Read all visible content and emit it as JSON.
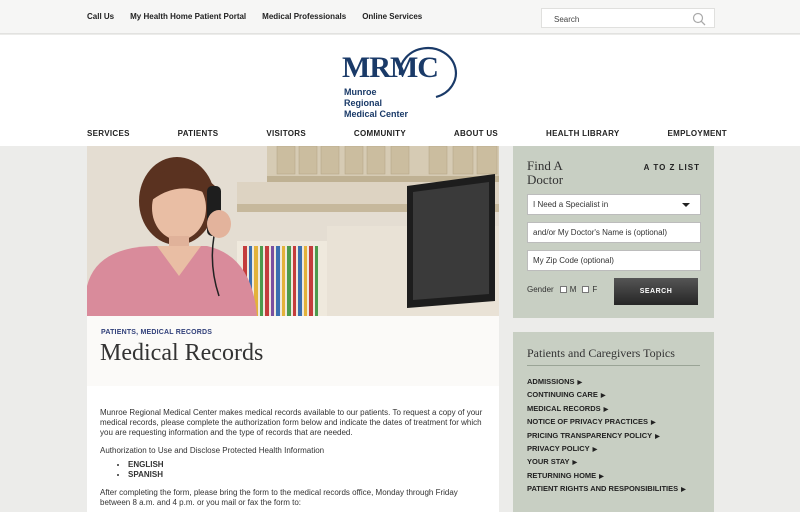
{
  "topbar": {
    "links": [
      "Call Us",
      "My Health Home Patient Portal",
      "Medical Professionals",
      "Online Services"
    ],
    "search_placeholder": "Search"
  },
  "logo": {
    "mark": "MRMC",
    "line1": "Munroe",
    "line2": "Regional",
    "line3": "Medical Center"
  },
  "nav": [
    "SERVICES",
    "PATIENTS",
    "VISITORS",
    "COMMUNITY",
    "ABOUT US",
    "HEALTH LIBRARY",
    "EMPLOYMENT"
  ],
  "hero": {
    "kicker": "PATIENTS, MEDICAL RECORDS",
    "title": "Medical Records"
  },
  "content": {
    "intro": "Munroe Regional Medical Center makes medical records available to our patients. To request a copy of your medical records, please complete the authorization form below and indicate the dates of treatment for which you are requesting information and the type of records that are needed.",
    "auth_label": "Authorization to Use and Disclose Protected Health Information",
    "forms": [
      "ENGLISH",
      "SPANISH"
    ],
    "after": "After completing the form, please bring the form to the medical records office, Monday through Friday between 8 a.m. and 4 p.m. or you mail or fax the form to:"
  },
  "find_doctor": {
    "title_line1": "Find A",
    "title_line2": "Doctor",
    "az_link": "A TO Z LIST",
    "specialist_select": "I Need a Specialist in",
    "name_placeholder": "and/or My Doctor's Name is (optional)",
    "zip_placeholder": "My Zip Code (optional)",
    "gender_label": "Gender",
    "gender_m": "M",
    "gender_f": "F",
    "search_button": "SEARCH"
  },
  "topics": {
    "title": "Patients and Caregivers Topics",
    "items": [
      "ADMISSIONS",
      "CONTINUING CARE",
      "MEDICAL RECORDS",
      "NOTICE OF PRIVACY PRACTICES",
      "PRICING TRANSPARENCY POLICY",
      "PRIVACY POLICY",
      "YOUR STAY",
      "RETURNING HOME",
      "PATIENT RIGHTS AND RESPONSIBILITIES"
    ]
  },
  "colors": {
    "brand_navy": "#1a3a68",
    "sidebar_bg": "#c8cfc3",
    "kicker": "#31407a"
  }
}
